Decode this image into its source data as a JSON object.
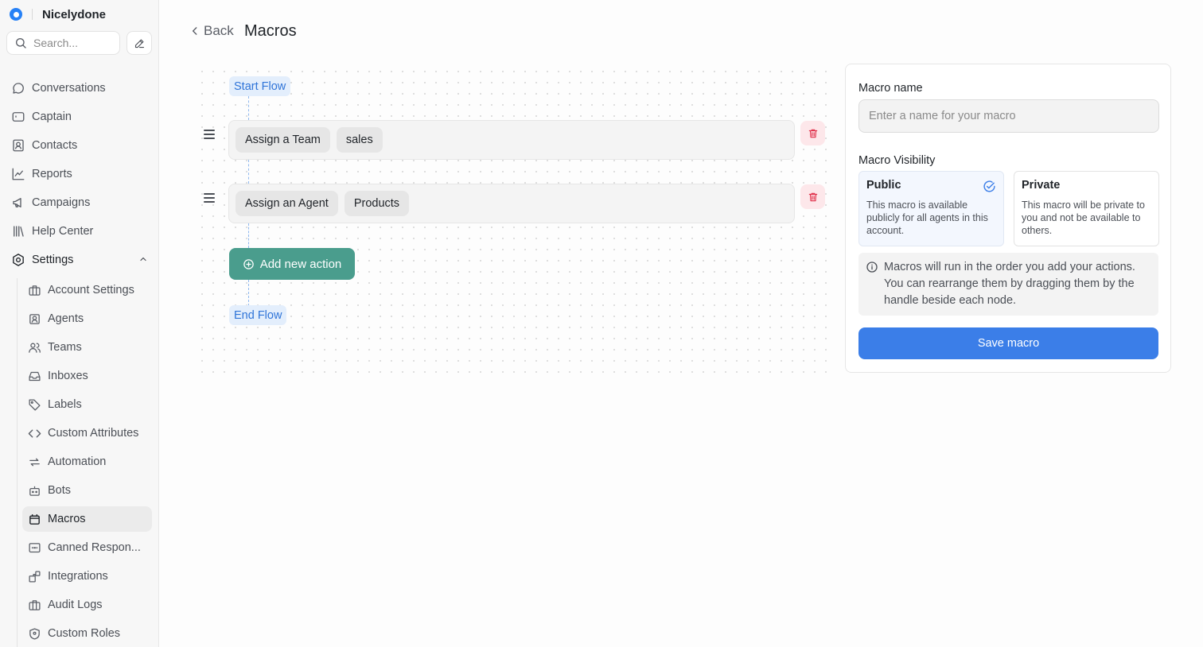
{
  "workspace": {
    "name": "Nicelydone"
  },
  "search": {
    "placeholder": "Search..."
  },
  "nav": {
    "items": [
      {
        "label": "Conversations",
        "icon": "chat-bubble-icon"
      },
      {
        "label": "Captain",
        "icon": "captain-icon"
      },
      {
        "label": "Contacts",
        "icon": "contact-card-icon"
      },
      {
        "label": "Reports",
        "icon": "line-chart-icon"
      },
      {
        "label": "Campaigns",
        "icon": "megaphone-icon"
      },
      {
        "label": "Help Center",
        "icon": "library-icon"
      }
    ],
    "settings_label": "Settings",
    "settings_items": [
      {
        "label": "Account Settings",
        "icon": "briefcase-icon"
      },
      {
        "label": "Agents",
        "icon": "user-square-icon"
      },
      {
        "label": "Teams",
        "icon": "users-icon"
      },
      {
        "label": "Inboxes",
        "icon": "inbox-icon"
      },
      {
        "label": "Labels",
        "icon": "tag-icon"
      },
      {
        "label": "Custom Attributes",
        "icon": "code-icon"
      },
      {
        "label": "Automation",
        "icon": "arrows-repeat-icon"
      },
      {
        "label": "Bots",
        "icon": "bot-icon"
      },
      {
        "label": "Macros",
        "icon": "macro-icon",
        "active": true
      },
      {
        "label": "Canned Respon...",
        "icon": "quote-message-icon"
      },
      {
        "label": "Integrations",
        "icon": "blocks-icon"
      },
      {
        "label": "Audit Logs",
        "icon": "briefcase-icon"
      },
      {
        "label": "Custom Roles",
        "icon": "shield-icon"
      }
    ]
  },
  "header": {
    "back_label": "Back",
    "title": "Macros"
  },
  "flow": {
    "start_label": "Start Flow",
    "end_label": "End Flow",
    "actions": [
      {
        "name": "Assign a Team",
        "value": "sales"
      },
      {
        "name": "Assign an Agent",
        "value": "Products"
      }
    ],
    "add_label": "Add new action"
  },
  "form": {
    "name_label": "Macro name",
    "name_placeholder": "Enter a name for your macro",
    "visibility_label": "Macro Visibility",
    "public": {
      "title": "Public",
      "desc": "This macro is available publicly for all agents in this account.",
      "selected": true
    },
    "private": {
      "title": "Private",
      "desc": "This macro will be private to you and not be available to others.",
      "selected": false
    },
    "note": "Macros will run in the order you add your actions. You can rearrange them by dragging them by the handle beside each node.",
    "save_label": "Save macro"
  },
  "colors": {
    "accent_blue": "#3b7ee8",
    "add_action_green": "#4a9d8d",
    "flow_pill_bg": "#e3eefc",
    "delete_red": "#e0314b"
  }
}
